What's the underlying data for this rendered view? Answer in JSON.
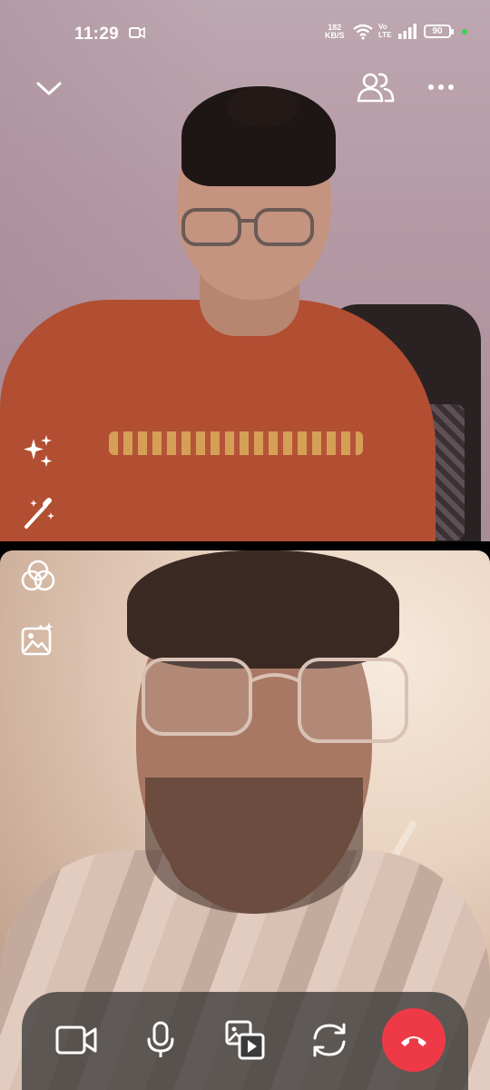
{
  "status_bar": {
    "time": "11:29",
    "net_speed": "182",
    "net_unit": "KB/S",
    "volte_top": "Vo",
    "volte_bottom": "LTE",
    "battery": "90",
    "icons": [
      "screen-record-icon",
      "wifi-icon",
      "signal-icon",
      "battery-icon"
    ]
  },
  "top_bar": {
    "icons": [
      "chevron-down-icon",
      "participants-icon",
      "more-icon"
    ]
  },
  "side_tools": {
    "icons": [
      "sparkles-icon",
      "magic-wand-icon",
      "filters-icon",
      "background-image-icon"
    ]
  },
  "call_controls": {
    "icons": [
      "video-camera-icon",
      "microphone-icon",
      "share-media-icon",
      "flip-camera-icon",
      "end-call-icon"
    ],
    "end_color": "#ee3a47"
  }
}
